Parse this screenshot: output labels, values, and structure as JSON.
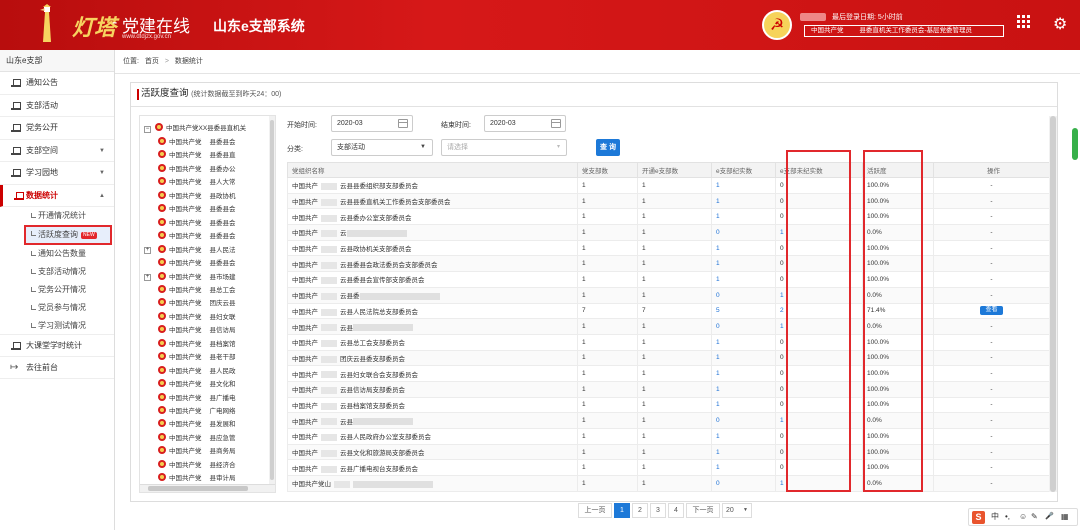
{
  "header": {
    "logo_main": "灯塔",
    "logo_dash": "-",
    "logo_sub": "党建在线",
    "logo_url": "www.dtdjzx.gov.cn",
    "system_title": "山东e支部系统",
    "login_label": "最后登录日期: 5小时前",
    "org_part1": "中国共产党",
    "org_part2": "县委直机关工作委员会-基层党委管理员"
  },
  "sidebar": {
    "title": "山东e支部",
    "items": [
      {
        "label": "通知公告"
      },
      {
        "label": "支部活动"
      },
      {
        "label": "党务公开"
      },
      {
        "label": "支部空间"
      },
      {
        "label": "学习园地"
      },
      {
        "label": "数据统计"
      }
    ],
    "subitems": [
      {
        "label": "开通情况统计"
      },
      {
        "label": "活跃度查询",
        "badge": "NEW"
      },
      {
        "label": "通知公告数量"
      },
      {
        "label": "支部活动情况"
      },
      {
        "label": "党务公开情况"
      },
      {
        "label": "党员参与情况"
      },
      {
        "label": "学习测试情况"
      }
    ],
    "bottom_items": [
      {
        "label": "大课堂学时统计"
      },
      {
        "label": "去往前台"
      }
    ]
  },
  "breadcrumb": {
    "prefix": "位置:",
    "home": "首页",
    "sep": ">",
    "current": "数据统计"
  },
  "panel": {
    "title": "活跃度查询",
    "note": "(统计数据截至到昨天24：00)"
  },
  "tree": {
    "root": "中国共产党XX县委县直机关",
    "nodes": [
      {
        "a": "中国共产党",
        "b": "县委县会"
      },
      {
        "a": "中国共产党",
        "b": "县委县直"
      },
      {
        "a": "中国共产党",
        "b": "县委办公"
      },
      {
        "a": "中国共产党",
        "b": "县人大常"
      },
      {
        "a": "中国共产党",
        "b": "县政协机"
      },
      {
        "a": "中国共产党",
        "b": "县委县会"
      },
      {
        "a": "中国共产党",
        "b": "县委县会"
      },
      {
        "a": "中国共产党",
        "b": "县委县会"
      },
      {
        "a": "中国共产党",
        "b": "县人民法"
      },
      {
        "a": "中国共产党",
        "b": "县委县会"
      },
      {
        "a": "中国共产党",
        "b": "县市场建"
      },
      {
        "a": "中国共产党",
        "b": "县总工会"
      },
      {
        "a": "中国共产党",
        "b": "团庆云县"
      },
      {
        "a": "中国共产党",
        "b": "县妇女联"
      },
      {
        "a": "中国共产党",
        "b": "县信访局"
      },
      {
        "a": "中国共产党",
        "b": "县档案馆"
      },
      {
        "a": "中国共产党",
        "b": "县老干部"
      },
      {
        "a": "中国共产党",
        "b": "县人民政"
      },
      {
        "a": "中国共产党",
        "b": "县文化和"
      },
      {
        "a": "中国共产党",
        "b": "县广播电"
      },
      {
        "a": "中国共产党",
        "b": "广电网络"
      },
      {
        "a": "中国共产党",
        "b": "县发展和"
      },
      {
        "a": "中国共产党",
        "b": "县应急管"
      },
      {
        "a": "中国共产党",
        "b": "县商务局"
      },
      {
        "a": "中国共产党",
        "b": "县经济合"
      },
      {
        "a": "中国共产党",
        "b": "县审计局"
      }
    ]
  },
  "filters": {
    "start_label": "开始时间:",
    "start_value": "2020-03",
    "end_label": "结束时间:",
    "end_value": "2020-03",
    "category_label": "分类:",
    "category_value": "支部活动",
    "select_placeholder": "请选择",
    "query_label": "查 询"
  },
  "table": {
    "headers": [
      "党组织名称",
      "党支部数",
      "开通e支部数",
      "e支部纪实数",
      "e支部未纪实数",
      "活跃度",
      "操作"
    ],
    "rows": [
      {
        "p": "中国共产",
        "n": "云县县委组织部支部委员会",
        "c1": "1",
        "c2": "1",
        "c3": "1",
        "c4": "0",
        "act": "100.0%",
        "op": "-"
      },
      {
        "p": "中国共产",
        "n": "云县县委直机关工作委员会支部委员会",
        "c1": "1",
        "c2": "1",
        "c3": "1",
        "c4": "0",
        "act": "100.0%",
        "op": "-"
      },
      {
        "p": "中国共产",
        "n": "云县委办公室支部委员会",
        "c1": "1",
        "c2": "1",
        "c3": "1",
        "c4": "0",
        "act": "100.0%",
        "op": "-"
      },
      {
        "p": "中国共产",
        "n": "云",
        "c1": "1",
        "c2": "1",
        "c3": "0",
        "c4": "1",
        "act": "0.0%",
        "op": "-",
        "blur": 1
      },
      {
        "p": "中国共产",
        "n": "云县政协机关支部委员会",
        "c1": "1",
        "c2": "1",
        "c3": "1",
        "c4": "0",
        "act": "100.0%",
        "op": "-"
      },
      {
        "p": "中国共产",
        "n": "云县委县会政法委员会支部委员会",
        "c1": "1",
        "c2": "1",
        "c3": "1",
        "c4": "0",
        "act": "100.0%",
        "op": "-"
      },
      {
        "p": "中国共产",
        "n": "云县委县会宣传部支部委员会",
        "c1": "1",
        "c2": "1",
        "c3": "1",
        "c4": "0",
        "act": "100.0%",
        "op": "-"
      },
      {
        "p": "中国共产",
        "n": "云县委",
        "c1": "1",
        "c2": "1",
        "c3": "0",
        "c4": "1",
        "act": "0.0%",
        "op": "-",
        "blur": 1
      },
      {
        "p": "中国共产",
        "n": "云县人民法院总支部委员会",
        "c1": "7",
        "c2": "7",
        "c3": "5",
        "c4": "2",
        "act": "71.4%",
        "op": "查看"
      },
      {
        "p": "中国共产",
        "n": "云县",
        "c1": "1",
        "c2": "1",
        "c3": "0",
        "c4": "1",
        "act": "0.0%",
        "op": "-",
        "blur": 1
      },
      {
        "p": "中国共产",
        "n": "云县总工会支部委员会",
        "c1": "1",
        "c2": "1",
        "c3": "1",
        "c4": "0",
        "act": "100.0%",
        "op": "-"
      },
      {
        "p": "中国共产",
        "n": "团庆云县委支部委员会",
        "c1": "1",
        "c2": "1",
        "c3": "1",
        "c4": "0",
        "act": "100.0%",
        "op": "-"
      },
      {
        "p": "中国共产",
        "n": "云县妇女联合会支部委员会",
        "c1": "1",
        "c2": "1",
        "c3": "1",
        "c4": "0",
        "act": "100.0%",
        "op": "-"
      },
      {
        "p": "中国共产",
        "n": "云县信访局支部委员会",
        "c1": "1",
        "c2": "1",
        "c3": "1",
        "c4": "0",
        "act": "100.0%",
        "op": "-"
      },
      {
        "p": "中国共产",
        "n": "云县档案馆支部委员会",
        "c1": "1",
        "c2": "1",
        "c3": "1",
        "c4": "0",
        "act": "100.0%",
        "op": "-"
      },
      {
        "p": "中国共产",
        "n": "云县",
        "c1": "1",
        "c2": "1",
        "c3": "0",
        "c4": "1",
        "act": "0.0%",
        "op": "-",
        "blur": 1
      },
      {
        "p": "中国共产",
        "n": "云县人民政府办公室支部委员会",
        "c1": "1",
        "c2": "1",
        "c3": "1",
        "c4": "0",
        "act": "100.0%",
        "op": "-"
      },
      {
        "p": "中国共产",
        "n": "云县文化和旅游局支部委员会",
        "c1": "1",
        "c2": "1",
        "c3": "1",
        "c4": "0",
        "act": "100.0%",
        "op": "-"
      },
      {
        "p": "中国共产",
        "n": "云县广播电视台支部委员会",
        "c1": "1",
        "c2": "1",
        "c3": "1",
        "c4": "0",
        "act": "100.0%",
        "op": "-"
      },
      {
        "p": "中国共产党山",
        "n": "",
        "c1": "1",
        "c2": "1",
        "c3": "0",
        "c4": "1",
        "act": "0.0%",
        "op": "-",
        "blur": 1
      }
    ]
  },
  "pagination": {
    "prev": "上一页",
    "pages": [
      "1",
      "2",
      "3",
      "4"
    ],
    "next": "下一页",
    "size": "20"
  },
  "ime": {
    "s": "S",
    "zh": "中",
    "symbols": "•,",
    "emoji": "☺",
    "pen": "✎",
    "mic": "🎤",
    "grid": "▦"
  },
  "colors": {
    "brand_red": "#c91212",
    "accent_blue": "#1d79d8",
    "highlight_red": "#e1282c"
  }
}
